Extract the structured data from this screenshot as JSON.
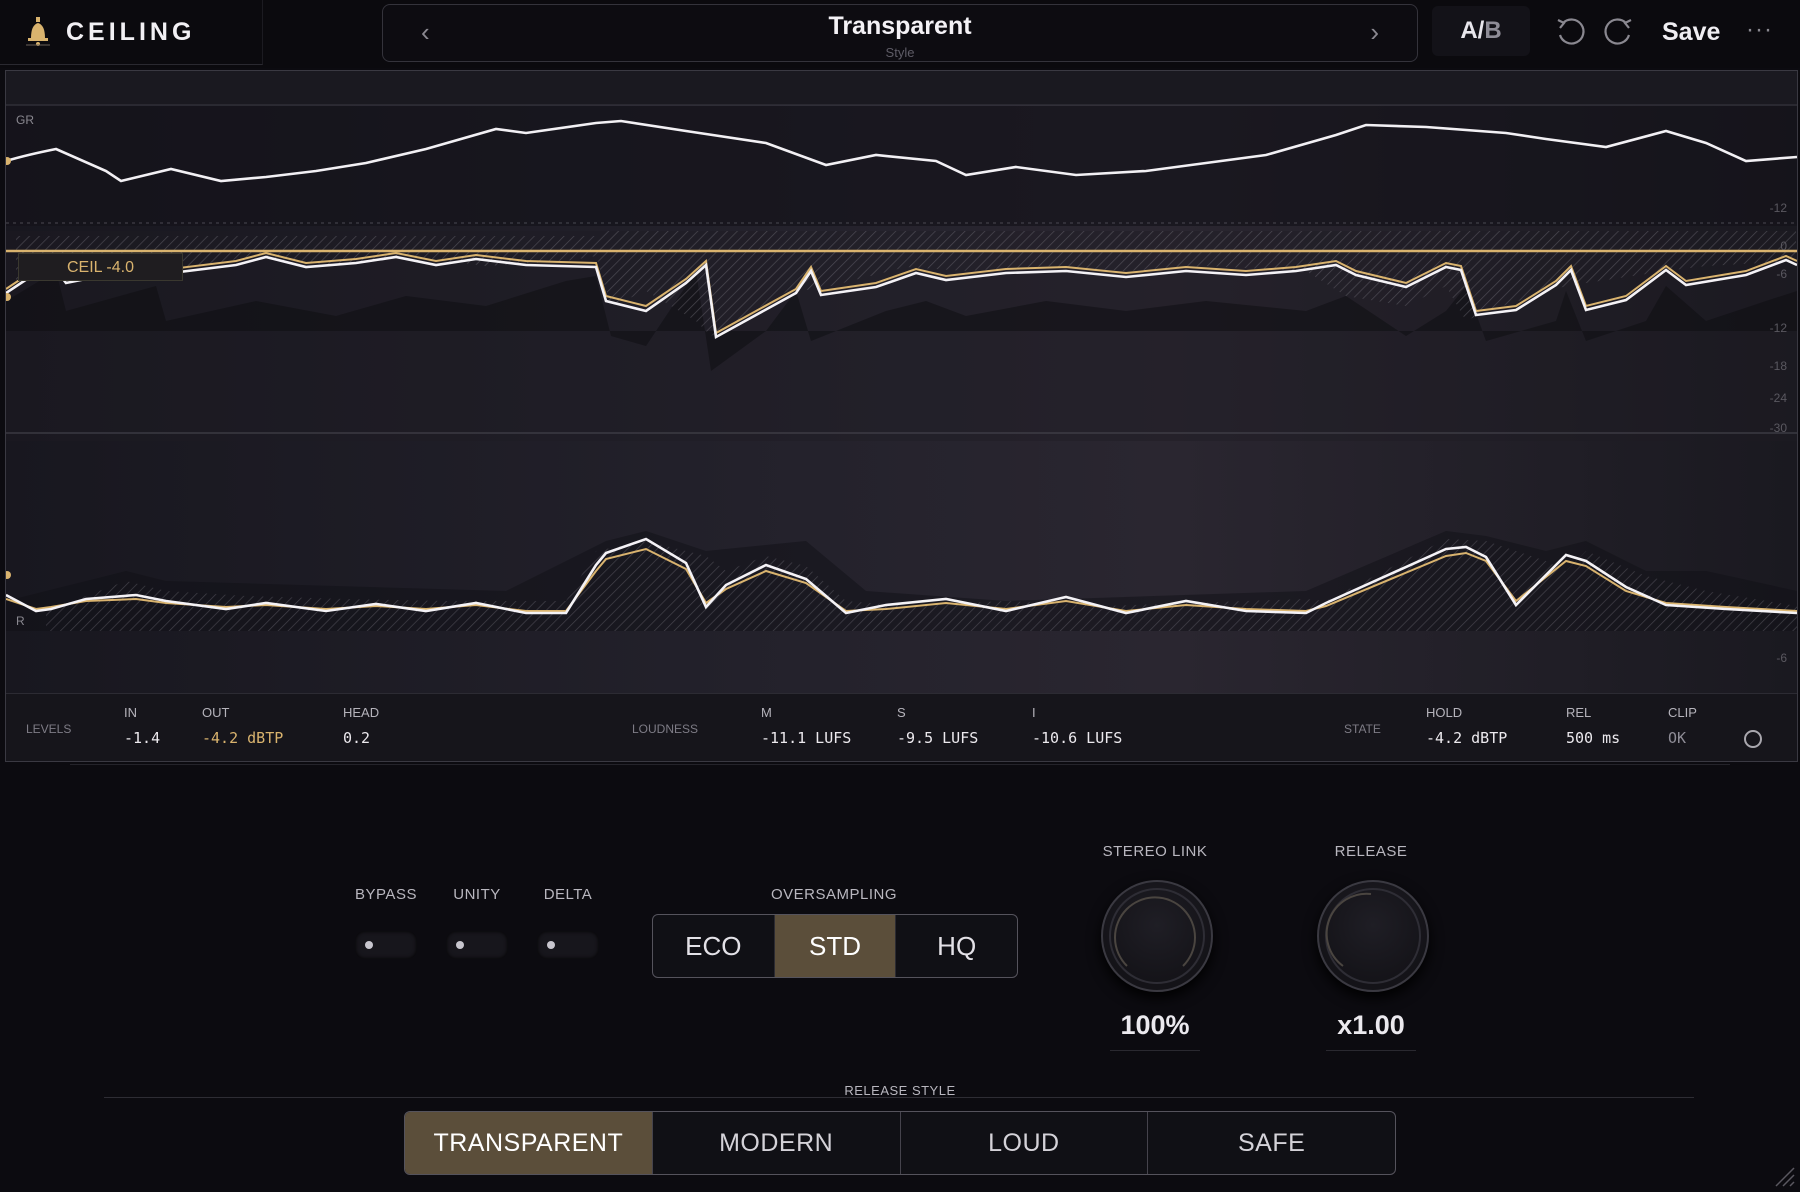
{
  "brand": {
    "name": "CEILING"
  },
  "preset": {
    "name": "Transparent",
    "sublabel": "Style",
    "prev_glyph": "‹",
    "next_glyph": "›"
  },
  "toolbar": {
    "ab_a": "A/",
    "ab_b": "B",
    "save_label": "Save",
    "more_glyph": "···"
  },
  "display": {
    "gr_label": "GR",
    "r_label": "R",
    "ceiling_tag": "CEIL -4.0",
    "scale": [
      "-12",
      "0",
      "-6",
      "-12",
      "-18",
      "-24",
      "-30",
      "-6"
    ]
  },
  "meter": {
    "levels_label": "LEVELS",
    "in_label": "IN",
    "in_value": "-1.4",
    "out_label": "OUT",
    "out_value": "-4.2 dBTP",
    "head_label": "HEAD",
    "head_value": "0.2",
    "loudness_label": "LOUDNESS",
    "m_label": "M",
    "m_value": "-11.1 LUFS",
    "s_label": "S",
    "s_value": "-9.5 LUFS",
    "i_label": "I",
    "i_value": "-10.6 LUFS",
    "state_label": "STATE",
    "hold_label": "HOLD",
    "hold_value": "-4.2 dBTP",
    "rel_label": "REL",
    "rel_value": "500 ms",
    "clip_label": "CLIP",
    "clip_value": "OK"
  },
  "controls": {
    "bypass_label": "BYPASS",
    "unity_label": "UNITY",
    "delta_label": "DELTA",
    "oversampling_label": "OVERSAMPLING",
    "oversampling_options": [
      "ECO",
      "STD",
      "HQ"
    ],
    "oversampling_selected": "STD",
    "stereo_link_label": "STEREO LINK",
    "stereo_link_value": "100%",
    "release_label": "RELEASE",
    "release_value": "x1.00",
    "release_style_label": "RELEASE STYLE",
    "release_style_options": [
      "TRANSPARENT",
      "MODERN",
      "LOUD",
      "SAFE"
    ],
    "release_style_selected": "TRANSPARENT"
  },
  "colors": {
    "accent": "#d9b36e",
    "active_bg": "#5b4e3a",
    "background": "#0c0b10"
  }
}
